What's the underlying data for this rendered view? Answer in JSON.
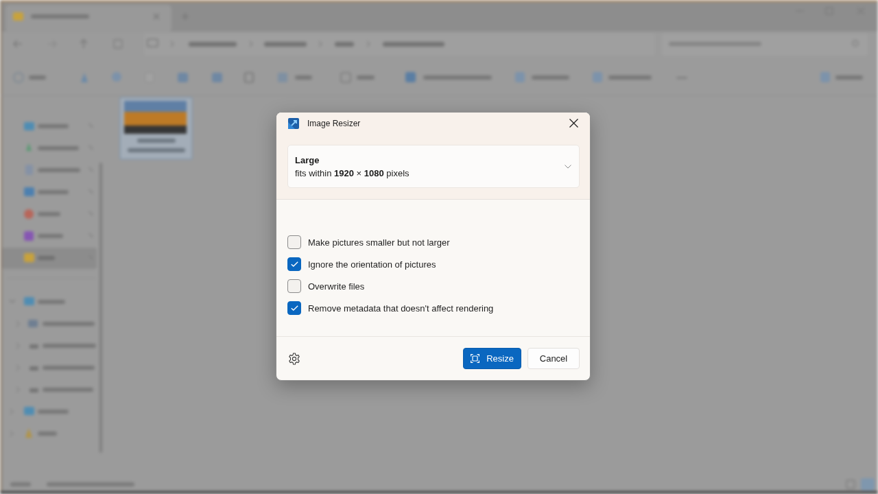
{
  "window": {
    "title": "Image Resizer"
  },
  "size_dropdown": {
    "name": "Large",
    "description": "fits within **1920** × **1080** pixels"
  },
  "options": [
    {
      "label": "Make pictures smaller but not larger",
      "checked": false
    },
    {
      "label": "Ignore the orientation of pictures",
      "checked": true
    },
    {
      "label": "Overwrite files",
      "checked": false
    },
    {
      "label": "Remove metadata that doesn't affect rendering",
      "checked": true
    }
  ],
  "buttons": [
    {
      "label": "Resize",
      "kind": "primary"
    },
    {
      "label": "Cancel",
      "kind": "secondary"
    }
  ]
}
